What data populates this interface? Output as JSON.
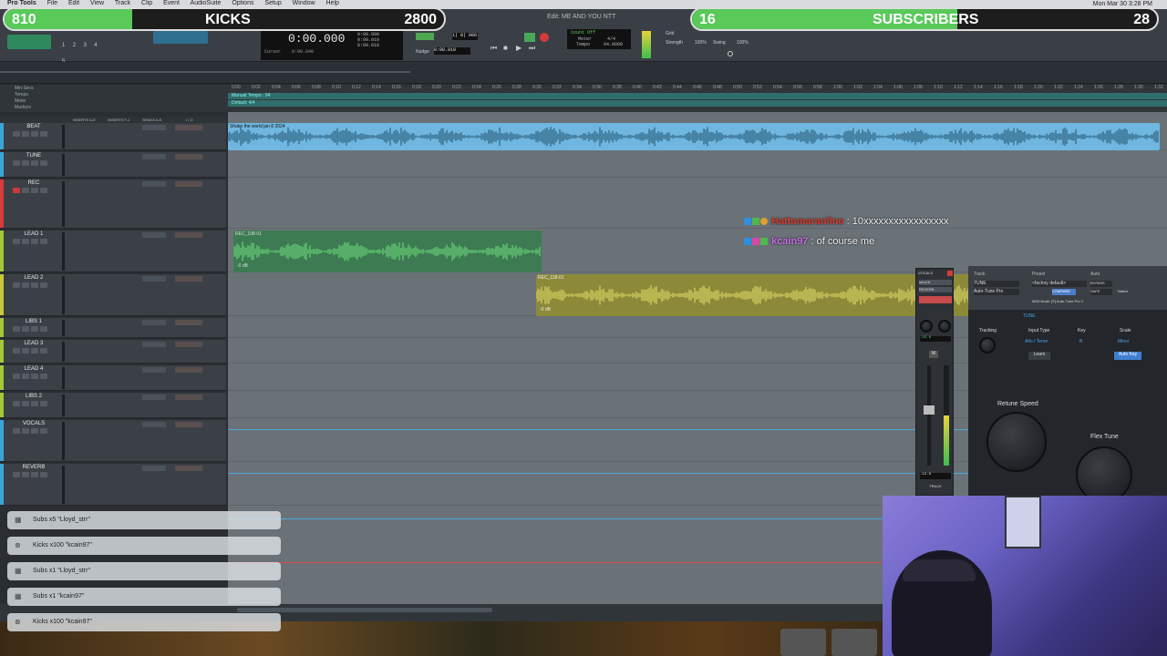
{
  "menubar": {
    "app": "Pro Tools",
    "items": [
      "File",
      "Edit",
      "View",
      "Track",
      "Clip",
      "Event",
      "AudioSuite",
      "Options",
      "Setup",
      "Window",
      "Help"
    ],
    "clock": "Mon Mar 30 3:28 PM"
  },
  "window": {
    "title": "Edit: ME AND YOU NTT"
  },
  "transport": {
    "main_counter": "0:00.000",
    "start": "0:00.000",
    "end": "0:00.010",
    "length": "0:00.010",
    "cursor_label": "Cursor",
    "cursor_value": "0:00.040",
    "nudge_label": "Nudge",
    "nudge_value": "0:00.010",
    "bars": "1| 0| 000",
    "count_off": "Count Off",
    "meter_label": "Meter",
    "meter_value": "4/4",
    "tempo_label": "Tempo",
    "tempo_value": "94.0000",
    "grid_label": "Grid",
    "strength_label": "Strength",
    "strength_value": "100%",
    "swing_label": "Swing",
    "swing_value": "100%",
    "selector_nums": [
      "1",
      "2",
      "3",
      "4",
      "5"
    ]
  },
  "rulers": {
    "labels": [
      "Min:Secs",
      "Tempo",
      "Meter",
      "Markers"
    ],
    "tempo_marker": "Manual Tempo : 94",
    "meter_marker": "Default: 4/4",
    "ticks": [
      "0:00",
      "0:02",
      "0:04",
      "0:06",
      "0:08",
      "0:10",
      "0:12",
      "0:14",
      "0:16",
      "0:18",
      "0:20",
      "0:22",
      "0:24",
      "0:26",
      "0:28",
      "0:30",
      "0:32",
      "0:34",
      "0:36",
      "0:38",
      "0:40",
      "0:42",
      "0:44",
      "0:46",
      "0:48",
      "0:50",
      "0:52",
      "0:54",
      "0:56",
      "0:58",
      "1:00",
      "1:02",
      "1:04",
      "1:06",
      "1:08",
      "1:10",
      "1:12",
      "1:14",
      "1:16",
      "1:18",
      "1:20",
      "1:22",
      "1:24",
      "1:26",
      "1:28",
      "1:30",
      "1:32"
    ]
  },
  "columns": {
    "inserts_ae": "INSERTS A-E",
    "inserts_fj": "INSERTS F-J",
    "sends_ae": "SENDS A-E",
    "io": "I / O"
  },
  "tracks": [
    {
      "name": "BEAT",
      "color": "#3aa6d8"
    },
    {
      "name": "TUNE",
      "color": "#3aa6d8"
    },
    {
      "name": "REC",
      "color": "#d83a3a"
    },
    {
      "name": "LEAD 1",
      "color": "#a3c93a"
    },
    {
      "name": "LEAD 2",
      "color": "#c9c93a"
    },
    {
      "name": "LIBS 1",
      "color": "#a3c93a"
    },
    {
      "name": "LEAD 3",
      "color": "#a3c93a"
    },
    {
      "name": "LEAD 4",
      "color": "#a3c93a"
    },
    {
      "name": "LIBS 2",
      "color": "#a3c93a"
    },
    {
      "name": "VOCALS",
      "color": "#3aa6d8"
    },
    {
      "name": "REVERB",
      "color": "#3aa6d8"
    }
  ],
  "clips": {
    "beat": "Shake the world jan 8 2024",
    "lead1": "REC_108-01",
    "lead2": "REC_118-01",
    "gain_lead1": "-0 dB",
    "gain_lead2": "-0 dB"
  },
  "overlay": {
    "kicks": {
      "left": "810",
      "center": "KICKS",
      "right": "2800",
      "progress": 0.29
    },
    "subs": {
      "left": "16",
      "center": "SUBSCRIBERS",
      "right": "28",
      "progress": 0.57
    }
  },
  "chat": [
    {
      "user": "Hattamaranline",
      "message": ": 10xxxxxxxxxxxxxxxxx"
    },
    {
      "user": "kcain97",
      "message": ": of course me"
    }
  ],
  "alerts": [
    {
      "icon": "gift-icon",
      "text": "Subs x5 \"Lloyd_strr\""
    },
    {
      "icon": "gift-icon",
      "text": "Kicks x100 \"kcain97\""
    },
    {
      "icon": "gift-icon",
      "text": "Subs x1 \"Lloyd_strr\""
    },
    {
      "icon": "gift-icon",
      "text": "Subs x1 \"kcain97\""
    },
    {
      "icon": "gift-icon",
      "text": "Kicks x100 \"kcain97\""
    }
  ],
  "mixer": {
    "track": "VOCALS",
    "insert": "send A",
    "send": "REVERB",
    "vol": "-16.0",
    "pan": "100",
    "fader_value": "-12.9",
    "mode": "TRACK"
  },
  "plugin": {
    "track_label": "Track",
    "preset_label": "Preset",
    "auto_label": "Auto",
    "track_value": "TUNE",
    "preset_value": "<factory default>",
    "plugin_name": "Auto-Tune Pro",
    "bypass": "BYPASS",
    "compare": "COMPARE",
    "safe": "SAFE",
    "native": "Native",
    "midi_node": "MIDI Node: [F] Auto-Tune Pro 1",
    "mode_tab": "TUNE",
    "tracking_label": "Tracking",
    "input_type_label": "Input Type",
    "input_type_value": "Alto / Tenor",
    "key_label": "Key",
    "key_value": "B",
    "scale_label": "Scale",
    "scale_value": "Minor",
    "learn": "Learn",
    "auto_key": "Auto Key",
    "retune_label": "Retune Speed",
    "flex_label": "Flex Tune"
  }
}
